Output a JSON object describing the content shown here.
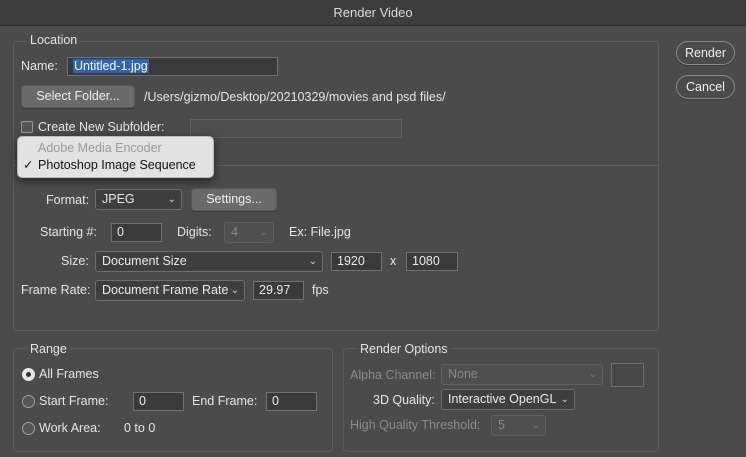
{
  "window": {
    "title": "Render Video"
  },
  "buttons": {
    "render": "Render",
    "cancel": "Cancel"
  },
  "location": {
    "legend": "Location",
    "name_label": "Name:",
    "name_value": "Untitled-1.jpg",
    "select_folder": "Select Folder...",
    "path": "/Users/gizmo/Desktop/20210329/movies and psd files/",
    "subfolder_label": "Create New Subfolder:",
    "subfolder_value": ""
  },
  "render_menu": {
    "items": [
      {
        "label": "Adobe Media Encoder",
        "enabled": false,
        "checked": false
      },
      {
        "label": "Photoshop Image Sequence",
        "enabled": true,
        "checked": true
      }
    ],
    "check_glyph": "✓"
  },
  "settings": {
    "format_label": "Format:",
    "format_value": "JPEG",
    "settings_button": "Settings...",
    "starting_label": "Starting #:",
    "starting_value": "0",
    "digits_label": "Digits:",
    "digits_value": "4",
    "example": "Ex: File.jpg",
    "size_label": "Size:",
    "size_value": "Document Size",
    "width": "1920",
    "x": "x",
    "height": "1080",
    "framerate_label": "Frame Rate:",
    "framerate_value": "Document Frame Rate",
    "fps_value": "29.97",
    "fps_unit": "fps"
  },
  "range": {
    "legend": "Range",
    "all_frames": "All Frames",
    "start_frame": "Start Frame:",
    "start_value": "0",
    "end_frame": "End Frame:",
    "end_value": "0",
    "work_area": "Work Area:",
    "work_area_value": "0 to 0",
    "selected": "All Frames"
  },
  "render_options": {
    "legend": "Render Options",
    "alpha_label": "Alpha Channel:",
    "alpha_value": "None",
    "quality_label": "3D Quality:",
    "quality_value": "Interactive OpenGL",
    "threshold_label": "High Quality Threshold:",
    "threshold_value": "5"
  },
  "icons": {
    "chevron": "chevron-down-icon",
    "checkmark": "checkmark-icon"
  }
}
